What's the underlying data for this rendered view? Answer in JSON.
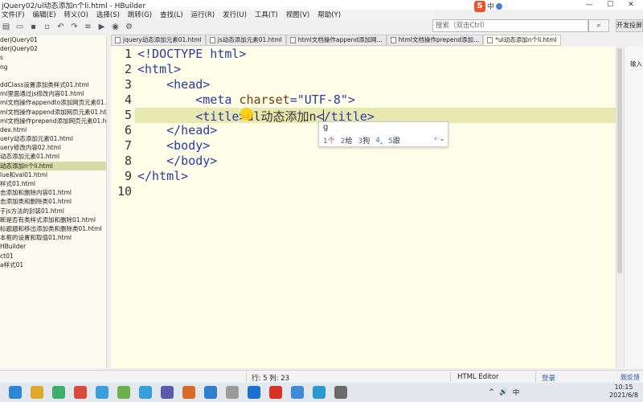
{
  "window": {
    "title": "jQuery02/ul动态添加n个li.html - HBuilder",
    "controls": [
      "—",
      "☐",
      "✕"
    ]
  },
  "ime_bar": {
    "logo": "S",
    "lang": "中"
  },
  "menu": [
    "文件(F)",
    "编辑(E)",
    "转义(O)",
    "选择(S)",
    "跳转(G)",
    "查找(L)",
    "运行(R)",
    "发行(U)",
    "工具(T)",
    "视图(V)",
    "帮助(Y)"
  ],
  "search": {
    "placeholder": "搜索（双击Ctrl）",
    "button": "⌕",
    "devices": "开发投屏"
  },
  "tree": {
    "items": [
      "derjQuery01",
      "derjQuery02",
      "s",
      "ng",
      "",
      "ddClass设置添加类样式01.html",
      "ml里面通过js修改内容01.html",
      "ml文档操作appendto添加网页元素01.html",
      "ml文档操作append添加网页元素01.html",
      "ml文档操作prepend添加网页元素01.html",
      "dex.html",
      "uery动态添加元素01.html",
      "uery修改内容02.html",
      "动态添加元素01.html",
      "动态添加n个li.html",
      "lue和val01.html",
      "样式01.html",
      "击添加和删除内容01.html",
      "击添加类和删除类01.html",
      "于js方法的封装01.html",
      "断是否有类样式添加和删除01.html",
      "标题题和移出添加类和删除类01.html",
      "本框的设置和取值01.html",
      "HBuilder",
      "ct01",
      "a样式01"
    ],
    "selected_index": 14
  },
  "tabs": [
    {
      "label": "jquery动态添加元素01.html",
      "active": false
    },
    {
      "label": "js动态添加元素01.html",
      "active": false
    },
    {
      "label": "html文档操作append添加网...",
      "active": false
    },
    {
      "label": "html文档操作prepend添加...",
      "active": false
    },
    {
      "label": "*ul动态添加n个li.html",
      "active": true
    }
  ],
  "editor": {
    "line_numbers": [
      "1",
      "2",
      "3",
      "4",
      "5",
      "6",
      "7",
      "8",
      "9",
      "10"
    ],
    "lines": [
      {
        "indent": "",
        "open": "<!DOCTYPE html>"
      },
      {
        "indent": "",
        "open": "<html>"
      },
      {
        "indent": "    ",
        "open": "<head>"
      },
      {
        "indent": "        ",
        "open": "<meta ",
        "attr": "charset",
        "eq": "=",
        "val": "\"UTF-8\"",
        "close": ">"
      },
      {
        "indent": "        ",
        "open": "<title>",
        "text": "ul动态添加n",
        "close": "</title>"
      },
      {
        "indent": "    ",
        "open": "</head>"
      },
      {
        "indent": "    ",
        "open": "<body>"
      },
      {
        "indent": "    ",
        "open": "</body>"
      },
      {
        "indent": "",
        "open": "</html>"
      },
      {
        "indent": "",
        "open": ""
      }
    ]
  },
  "ime_popup": {
    "input": "g",
    "candidates": [
      {
        "num": "1",
        "text": "个"
      },
      {
        "num": "2",
        "text": "给"
      },
      {
        "num": "3",
        "text": "狗"
      },
      {
        "num": "4",
        "text": "‸"
      },
      {
        "num": "5",
        "text": "跟"
      }
    ],
    "nav": "›  ⌄"
  },
  "right_panel": {
    "label": "输入"
  },
  "status": {
    "position": "行: 5 列: 23",
    "mode": "HTML Editor",
    "login": "登录",
    "report": "题反馈"
  },
  "clock": {
    "time": "10:15",
    "date": "2021/6/8"
  },
  "tray": [
    "^",
    "🔊",
    "中"
  ]
}
